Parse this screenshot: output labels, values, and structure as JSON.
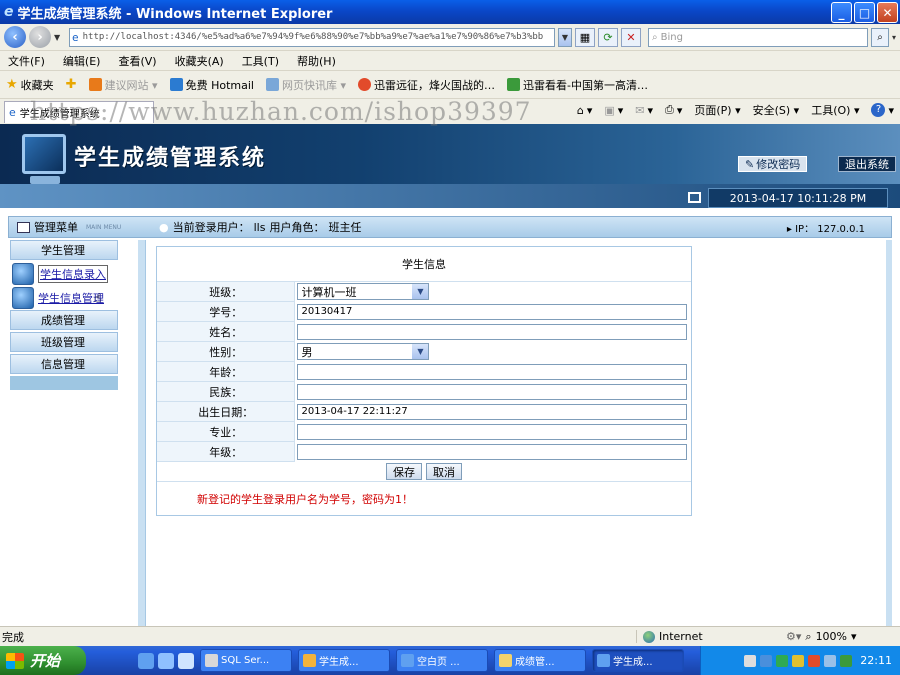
{
  "window": {
    "title": "学生成绩管理系统 - Windows Internet Explorer",
    "minimize": "_",
    "maximize": "□",
    "close": "✕"
  },
  "address": {
    "url": "http://localhost:4346/%e5%ad%a6%e7%94%9f%e6%88%90%e7%bb%a9%e7%ae%a1%e7%90%86%e7%b3%bb",
    "search_placeholder": "Bing"
  },
  "menu": [
    "文件(F)",
    "编辑(E)",
    "查看(V)",
    "收藏夹(A)",
    "工具(T)",
    "帮助(H)"
  ],
  "favorites": {
    "favorites_label": "收藏夹",
    "items": [
      {
        "label": "建议网站 ▾",
        "muted": true,
        "color": "#e87a1a"
      },
      {
        "label": "免费 Hotmail",
        "muted": false,
        "color": "#2b7bd1"
      },
      {
        "label": "网页快讯库 ▾",
        "muted": true,
        "color": "#7aa7d8"
      },
      {
        "label": "迅雷远征，烽火国战的…",
        "muted": false,
        "color": "#e24b2b"
      },
      {
        "label": "迅雷看看-中国第一高清…",
        "muted": false,
        "color": "#3b9a3b"
      }
    ]
  },
  "tab": {
    "title": "学生成绩管理系统"
  },
  "commands": [
    "页面(P) ▾",
    "安全(S) ▾",
    "工具(O) ▾"
  ],
  "watermark": "https://www.huzhan.com/ishop39397",
  "app": {
    "title": "学生成绩管理系统",
    "change_password": "修改密码",
    "logout": "退出系统",
    "datetime": "2013-04-17 10:11:28 PM",
    "menu_title": "管理菜单",
    "menu_subtitle": "MAIN MENU",
    "current_user_label": "当前登录用户：",
    "current_user": "lls",
    "role_label": "用户角色：",
    "role": "班主任",
    "ip_label": "IP：",
    "ip": "127.0.0.1"
  },
  "sidebar": {
    "student_mgmt": "学生管理",
    "sub_add": "学生信息录入",
    "sub_manage": "学生信息管理",
    "grades_mgmt": "成绩管理",
    "class_mgmt": "班级管理",
    "info_mgmt": "信息管理"
  },
  "form": {
    "caption": "学生信息",
    "class_label": "班级：",
    "class_value": "计算机一班",
    "id_label": "学号：",
    "id_value": "20130417",
    "name_label": "姓名：",
    "name_value": "",
    "gender_label": "性别：",
    "gender_value": "男",
    "age_label": "年龄：",
    "age_value": "",
    "ethnic_label": "民族：",
    "ethnic_value": "",
    "birth_label": "出生日期：",
    "birth_value": "2013-04-17 22:11:27",
    "major_label": "专业：",
    "major_value": "",
    "grade_label": "年级：",
    "grade_value": "",
    "save": "保存",
    "cancel": "取消",
    "note": "新登记的学生登录用户名为学号，密码为1！"
  },
  "status": {
    "left": "完成",
    "zone": "Internet",
    "zoom": "100%"
  },
  "taskbar": {
    "start": "开始",
    "tasks": [
      {
        "label": "SQL Ser...",
        "color": "#d8d8d8",
        "active": false
      },
      {
        "label": "学生成...",
        "color": "#f2b33d",
        "active": false
      },
      {
        "label": "空白页 ...",
        "color": "#5fa0f0",
        "active": false
      },
      {
        "label": "成绩管...",
        "color": "#f4d36b",
        "active": false
      },
      {
        "label": "学生成...",
        "color": "#5fa0f0",
        "active": true
      }
    ],
    "clock": "22:11"
  }
}
